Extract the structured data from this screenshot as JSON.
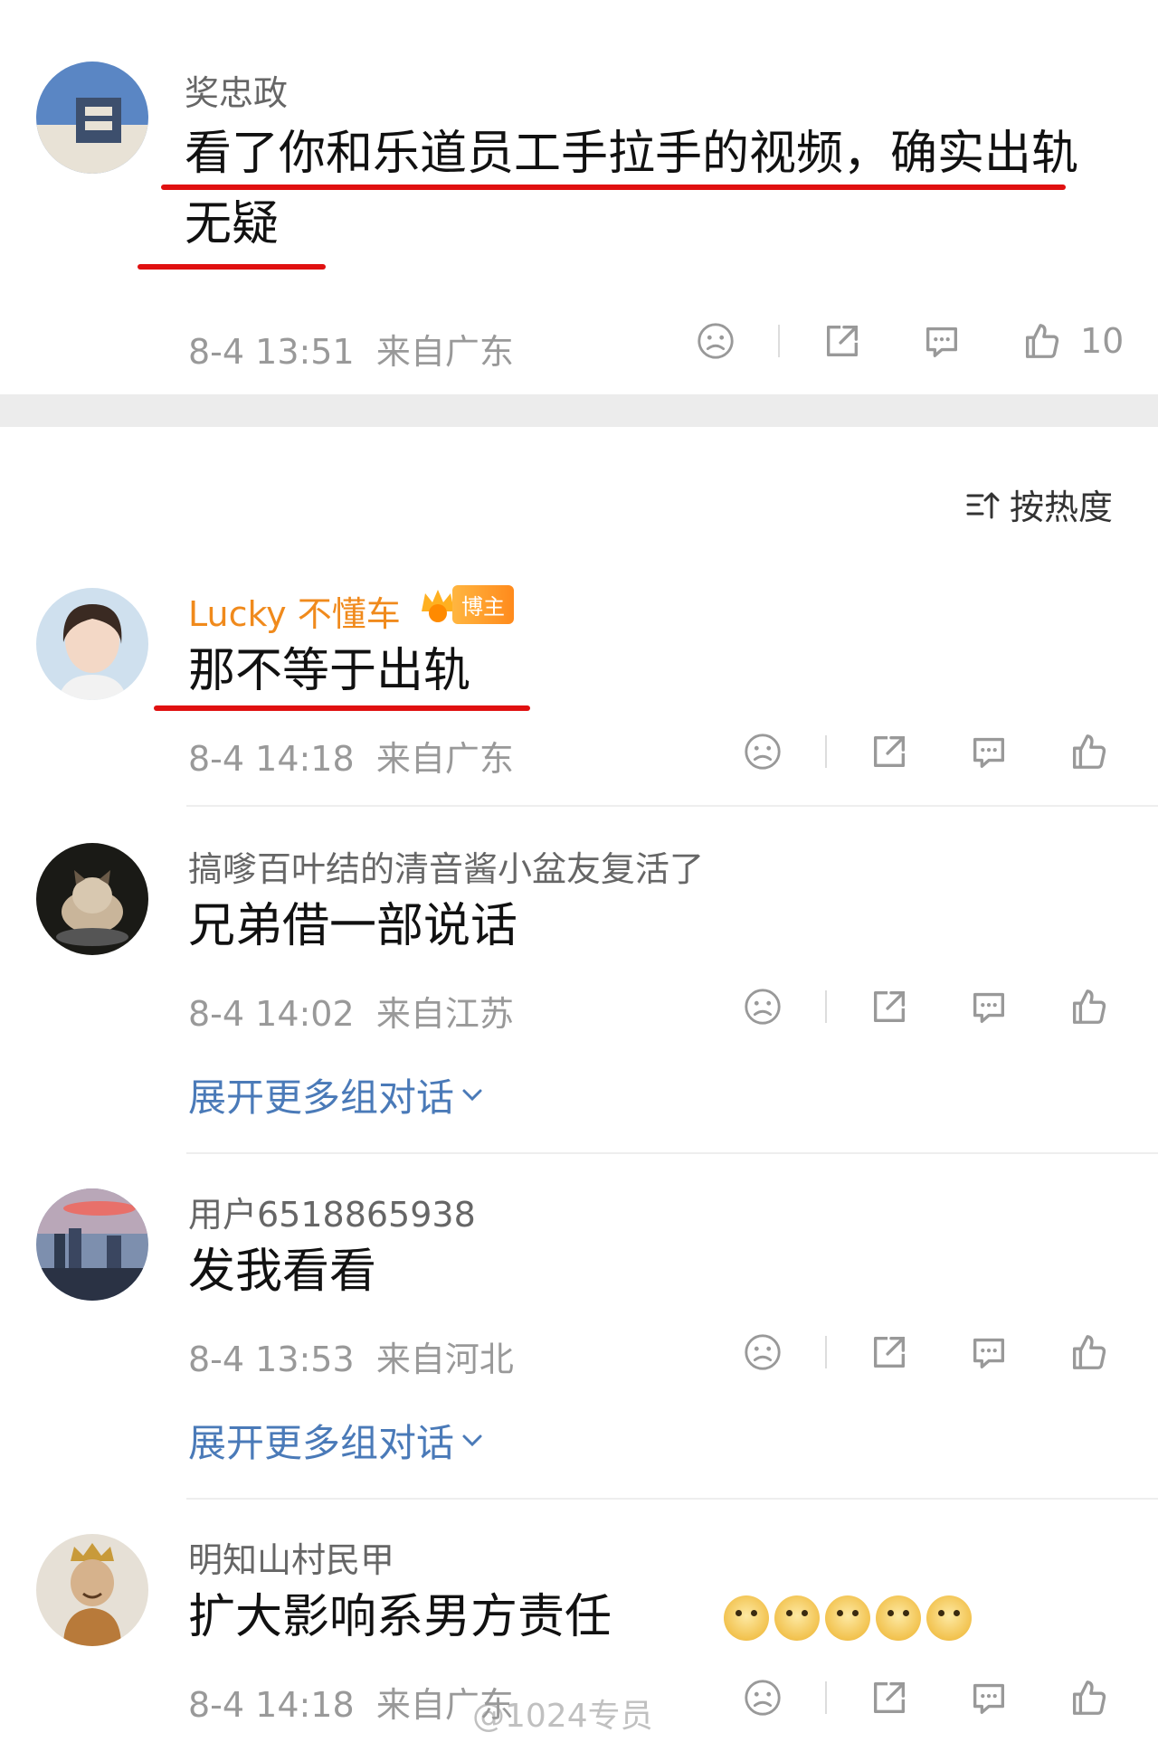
{
  "post": {
    "author": "奖忠政",
    "text_line1": "看了你和乐道员工手拉手的视频，确实出轨",
    "text_line2": "无疑",
    "time": "8-4 13:51",
    "location": "来自广东",
    "like_count": "10"
  },
  "sort_label": "按热度",
  "comments": [
    {
      "author": "Lucky 不懂车",
      "badge": "博主",
      "badge_level": "5",
      "text": "那不等于出轨",
      "time": "8-4 14:18",
      "location": "来自广东"
    },
    {
      "author": "搞嗲百叶结的清音酱小盆友复活了",
      "text": "兄弟借一部说话",
      "time": "8-4 14:02",
      "location": "来自江苏",
      "expand_label": "展开更多组对话"
    },
    {
      "author": "用户6518865938",
      "text": "发我看看",
      "time": "8-4 13:53",
      "location": "来自河北",
      "expand_label": "展开更多组对话"
    },
    {
      "author": "明知山村民甲",
      "text": "扩大影响系男方责任",
      "time": "8-4 14:18",
      "location": "来自广东"
    }
  ],
  "watermark": "@1024专员",
  "colors": {
    "highlight_underline": "#e01010",
    "blogger_name": "#f08a1c",
    "expand_link": "#4a7ab8",
    "section_gap": "#ececec"
  },
  "icons": [
    "sad-face-icon",
    "share-icon",
    "comment-icon",
    "like-icon",
    "sort-icon",
    "chevron-down-icon",
    "crown-icon",
    "doge-emoji-icon"
  ]
}
